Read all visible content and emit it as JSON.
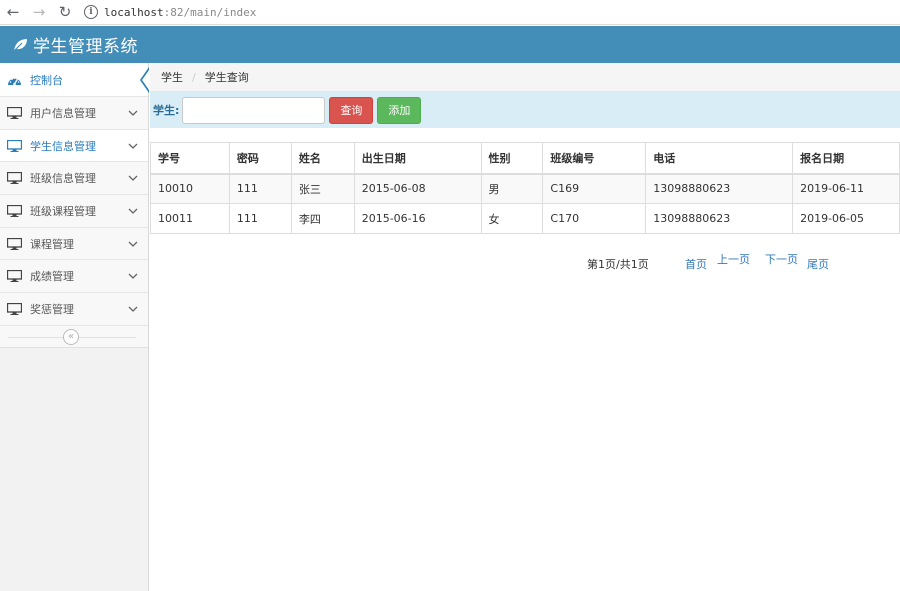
{
  "browser": {
    "url_host": "localhost",
    "url_rest": ":82/main/index"
  },
  "header": {
    "title": "学生管理系统"
  },
  "sidebar": {
    "items": [
      {
        "label": "控制台"
      },
      {
        "label": "用户信息管理"
      },
      {
        "label": "学生信息管理"
      },
      {
        "label": "班级信息管理"
      },
      {
        "label": "班级课程管理"
      },
      {
        "label": "课程管理"
      },
      {
        "label": "成绩管理"
      },
      {
        "label": "奖惩管理"
      }
    ],
    "collapse_glyph": "«"
  },
  "breadcrumb": {
    "items": [
      "学生",
      "学生查询"
    ],
    "separator": "/"
  },
  "search": {
    "label": "学生:",
    "value": "",
    "placeholder": "",
    "query_button": "查询",
    "add_button": "添加"
  },
  "table": {
    "columns": [
      "学号",
      "密码",
      "姓名",
      "出生日期",
      "性别",
      "班级编号",
      "电话",
      "报名日期"
    ],
    "rows": [
      [
        "10010",
        "111",
        "张三",
        "2015-06-08",
        "男",
        "C169",
        "13098880623",
        "2019-06-11"
      ],
      [
        "10011",
        "111",
        "李四",
        "2015-06-16",
        "女",
        "C170",
        "13098880623",
        "2019-06-05"
      ]
    ]
  },
  "pager": {
    "info": "第1页/共1页",
    "first": "首页",
    "prev": "上一页",
    "next": "下一页",
    "last": "尾页"
  },
  "colors": {
    "header": "#438eb9",
    "active_text": "#2b7dbc",
    "search_bar": "#d9edf7",
    "query_button": "#d9534f",
    "add_button": "#5cb85c",
    "link": "#337ab7"
  }
}
